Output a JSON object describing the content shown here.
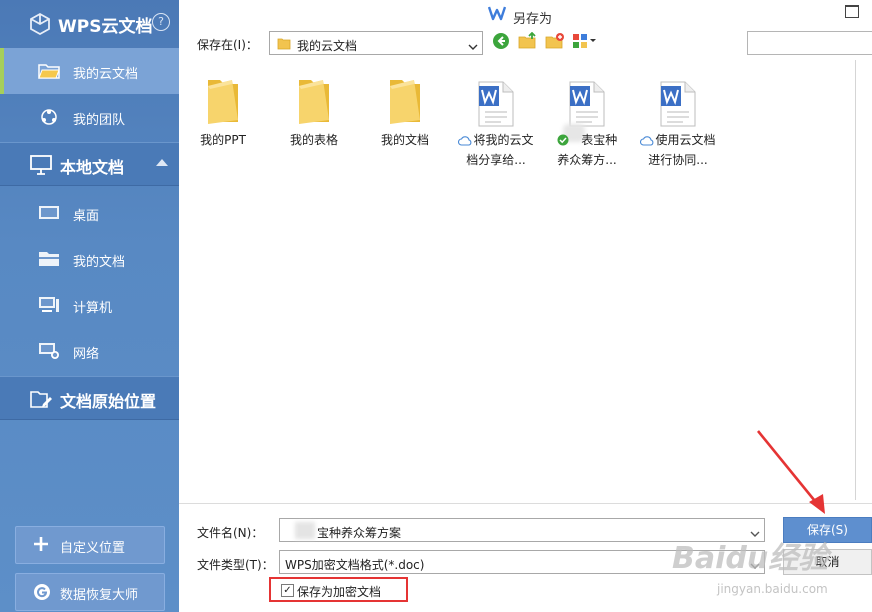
{
  "sidebar": {
    "brand": "WPS云文档",
    "help": "?",
    "cloud_items": [
      {
        "label": "我的云文档",
        "icon": "folder-icon",
        "active": true
      },
      {
        "label": "我的团队",
        "icon": "team-icon",
        "active": false
      }
    ],
    "local_section": "本地文档",
    "local_items": [
      {
        "label": "桌面",
        "icon": "desktop-icon"
      },
      {
        "label": "我的文档",
        "icon": "documents-icon"
      },
      {
        "label": "计算机",
        "icon": "computer-icon"
      },
      {
        "label": "网络",
        "icon": "network-icon"
      }
    ],
    "origin_section": "文档原始位置",
    "buttons": [
      {
        "label": "自定义位置",
        "icon": "plus-icon"
      },
      {
        "label": "数据恢复大师",
        "icon": "recovery-icon"
      }
    ]
  },
  "dialog": {
    "title": "另存为",
    "location_label": "保存在(I)：",
    "location_value": "我的云文档",
    "files": [
      {
        "name": [
          "我的PPT"
        ],
        "type": "folder"
      },
      {
        "name": [
          "我的表格"
        ],
        "type": "folder"
      },
      {
        "name": [
          "我的文档"
        ],
        "type": "folder"
      },
      {
        "name": [
          "将我的云文",
          "档分享给..."
        ],
        "type": "doc",
        "status": "cloud"
      },
      {
        "name": [
          "表宝种",
          "养众筹方..."
        ],
        "type": "doc",
        "status": "synced"
      },
      {
        "name": [
          "使用云文档",
          "进行协同..."
        ],
        "type": "doc",
        "status": "cloud"
      }
    ],
    "filename_label": "文件名(N)：",
    "filename_value": "宝种养众筹方案",
    "filetype_label": "文件类型(T)：",
    "filetype_value": "WPS加密文档格式(*.doc)",
    "save_button": "保存(S)",
    "cancel_button": "取消",
    "encrypt_checkbox": {
      "label": "保存为加密文档",
      "checked": true
    }
  },
  "watermark": {
    "text": "Baidu经验",
    "sub": "jingyan.baidu.com"
  },
  "colors": {
    "sidebar": "#5587c3",
    "accent": "#5e8fcf",
    "highlight": "#e53434"
  }
}
